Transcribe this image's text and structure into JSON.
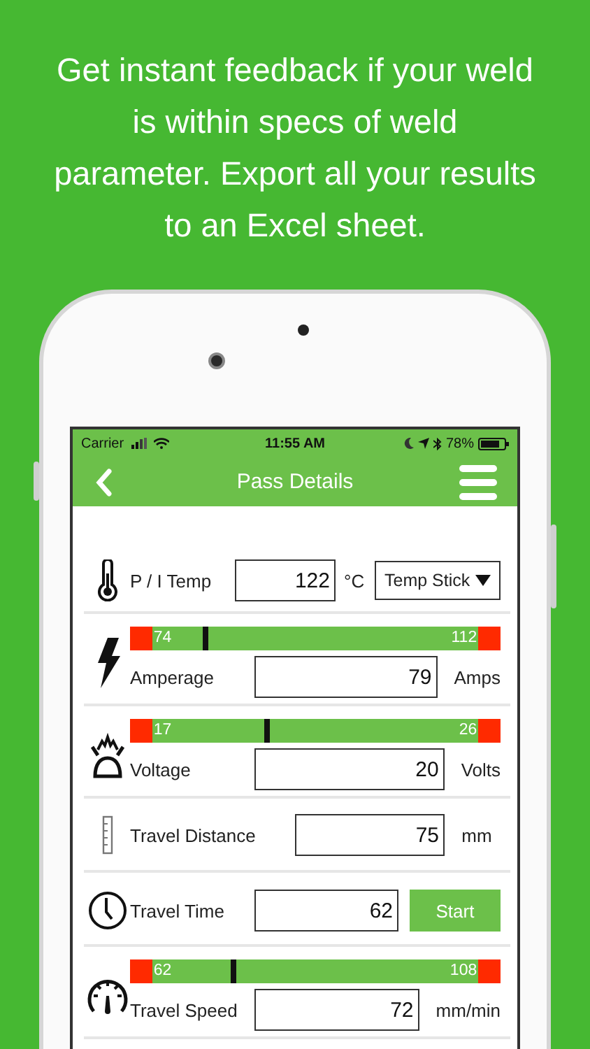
{
  "headline": "Get instant feedback if your weld is within specs of weld parameter. Export all your results to an Excel sheet.",
  "status_bar": {
    "carrier": "Carrier",
    "time": "11:55 AM",
    "battery": "78%"
  },
  "nav": {
    "title": "Pass Details"
  },
  "rows": [
    {
      "kind": "temp",
      "label": "P / I Temp",
      "value": "122",
      "unit": "°C",
      "select": "Temp Stick"
    },
    {
      "kind": "gauge",
      "label": "Amperage",
      "value": "79",
      "unit": "Amps",
      "min": "74",
      "max": "112",
      "level": 0.196
    },
    {
      "kind": "gauge",
      "label": "Voltage",
      "value": "20",
      "unit": "Volts",
      "min": "17",
      "max": "26",
      "level": 0.363
    },
    {
      "kind": "measure",
      "label": "Travel Distance",
      "value": "75",
      "unit": "mm"
    },
    {
      "kind": "timer",
      "label": "Travel Time",
      "value": "62",
      "button": "Start"
    },
    {
      "kind": "gauge",
      "label": "Travel Speed",
      "value": "72",
      "unit": "mm/min",
      "min": "62",
      "max": "108",
      "level": 0.27
    }
  ]
}
